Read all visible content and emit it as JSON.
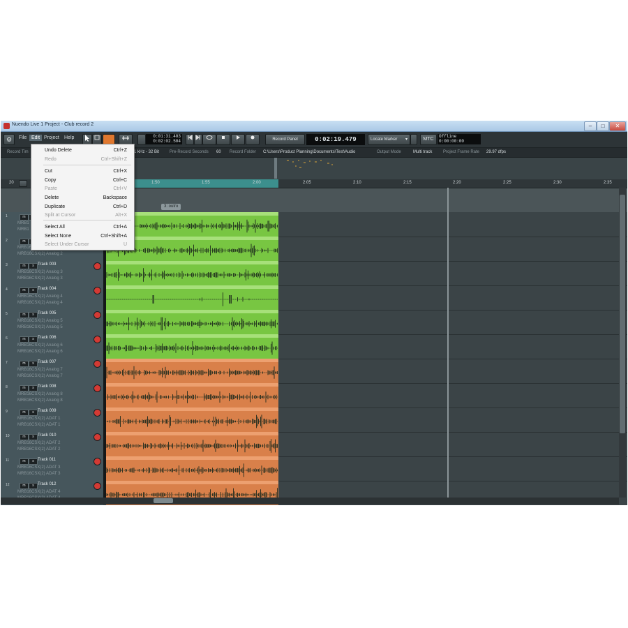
{
  "window": {
    "title": "Nuendo Live 1 Project - Club record 2",
    "minimize": "–",
    "maximize": "□",
    "close": "✕"
  },
  "menubar": {
    "file": "File",
    "edit": "Edit",
    "project": "Project",
    "help": "Help"
  },
  "transport": {
    "time1": "0:01:31.403",
    "time2": "0:02:02.504",
    "record_panel": "Record Panel",
    "main_time": "0:02:19.479",
    "locate_marker": "Locate Marker",
    "mtc": "MTC",
    "status1": "Offline",
    "status2": "0:00:00:00"
  },
  "infobar": {
    "record_time_label": "Record Tim",
    "format": "1 kHz - 32 Bit",
    "pre_record_label": "Pre-Record Seconds",
    "pre_record_value": "60",
    "record_folder_label": "Record Folder",
    "record_folder_value": "C:\\Users\\Product Planning\\Documents\\Test\\Audio",
    "output_mode_label": "Output Mode",
    "output_mode_value": "Multi track",
    "frame_rate_label": "Project Frame Rate",
    "frame_rate_value": "29.97 dfps"
  },
  "ruler": {
    "left_value": "20",
    "ticks": [
      "1:50",
      "1:55",
      "2:00",
      "2:05",
      "2:10",
      "2:15",
      "2:20",
      "2:25",
      "2:30",
      "2:35"
    ]
  },
  "marker": {
    "label": "3: outro"
  },
  "edit_menu": [
    {
      "label": "Undo Delete",
      "shortcut": "Ctrl+Z",
      "enabled": true
    },
    {
      "label": "Redo",
      "shortcut": "Ctrl+Shift+Z",
      "enabled": false
    },
    {
      "label": "Cut",
      "shortcut": "Ctrl+X",
      "enabled": true
    },
    {
      "label": "Copy",
      "shortcut": "Ctrl+C",
      "enabled": true
    },
    {
      "label": "Paste",
      "shortcut": "Ctrl+V",
      "enabled": false
    },
    {
      "label": "Delete",
      "shortcut": "Backspace",
      "enabled": true
    },
    {
      "label": "Duplicate",
      "shortcut": "Ctrl+D",
      "enabled": true
    },
    {
      "label": "Split at Cursor",
      "shortcut": "Alt+X",
      "enabled": false
    },
    {
      "label": "Select All",
      "shortcut": "Ctrl+A",
      "enabled": true
    },
    {
      "label": "Select None",
      "shortcut": "Ctrl+Shift+A",
      "enabled": true
    },
    {
      "label": "Select Under Cursor",
      "shortcut": "U",
      "enabled": false
    }
  ],
  "tracks": [
    {
      "num": "1",
      "name": "",
      "sub1": "MRB1",
      "sub2": "MRB1",
      "color": "green"
    },
    {
      "num": "2",
      "name": "",
      "sub1": "MRB16CSX(2) Analog 2",
      "sub2": "MRB16CSX(2) Analog 2",
      "color": "green"
    },
    {
      "num": "3",
      "name": "Track 003",
      "sub1": "MRB16CSX(2) Analog 3",
      "sub2": "MRB16CSX(2) Analog 3",
      "color": "green"
    },
    {
      "num": "4",
      "name": "Track 004",
      "sub1": "MRB16CSX(2) Analog 4",
      "sub2": "MRB16CSX(2) Analog 4",
      "color": "green"
    },
    {
      "num": "5",
      "name": "Track 005",
      "sub1": "MRB16CSX(2) Analog 5",
      "sub2": "MRB16CSX(2) Analog 5",
      "color": "green"
    },
    {
      "num": "6",
      "name": "Track 006",
      "sub1": "MRB16CSX(2) Analog 6",
      "sub2": "MRB16CSX(2) Analog 6",
      "color": "green"
    },
    {
      "num": "7",
      "name": "Track 007",
      "sub1": "MRB16CSX(2) Analog 7",
      "sub2": "MRB16CSX(2) Analog 7",
      "color": "orange"
    },
    {
      "num": "8",
      "name": "Track 008",
      "sub1": "MRB16CSX(2) Analog 8",
      "sub2": "MRB16CSX(2) Analog 8",
      "color": "orange"
    },
    {
      "num": "9",
      "name": "Track 009",
      "sub1": "MRB16CSX(2) ADAT 1",
      "sub2": "MRB16CSX(2) ADAT 1",
      "color": "orange"
    },
    {
      "num": "10",
      "name": "Track 010",
      "sub1": "MRB16CSX(2) ADAT 2",
      "sub2": "MRB16CSX(2) ADAT 2",
      "color": "orange"
    },
    {
      "num": "11",
      "name": "Track 011",
      "sub1": "MRB16CSX(2) ADAT 3",
      "sub2": "MRB16CSX(2) ADAT 3",
      "color": "orange"
    },
    {
      "num": "12",
      "name": "Track 012",
      "sub1": "MRB16CSX(2) ADAT 4",
      "sub2": "MRB16CSX(2) ADAT 4",
      "color": "orange"
    }
  ],
  "track_buttons": {
    "mute": "m",
    "solo": "s"
  },
  "icons": {
    "settings": "gear-icon",
    "pointer": "pointer-icon",
    "record": "record-icon",
    "play": "play-icon",
    "stop": "stop-icon",
    "cycle": "cycle-icon"
  },
  "colors": {
    "green_clip": "#78c642",
    "orange_clip": "#d9804a",
    "ruler_selection": "#3c8f8d",
    "record_button": "#d33a34"
  }
}
